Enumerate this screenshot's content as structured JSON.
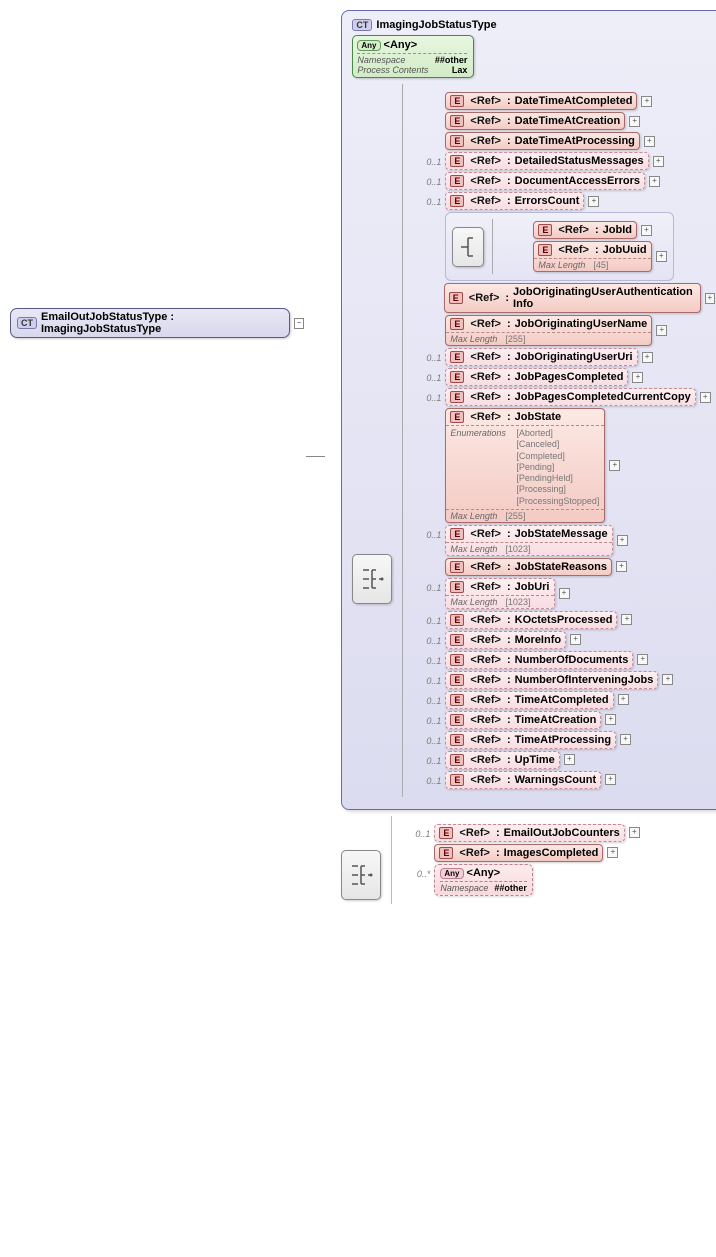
{
  "root": {
    "ct_badge": "CT",
    "label": "EmailOutJobStatusType : ImagingJobStatusType"
  },
  "group": {
    "ct_badge": "CT",
    "title": "ImagingJobStatusType",
    "any": {
      "badge": "Any",
      "title": "<Any>",
      "ns_k": "Namespace",
      "ns_v": "##other",
      "pc_k": "Process Contents",
      "pc_v": "Lax"
    }
  },
  "ref_label": "<Ref>",
  "e_badge": "E",
  "plus": "+",
  "minus": "−",
  "occ01": "0..1",
  "occ0s": "0..*",
  "meta": {
    "maxlen_k": "Max Length",
    "maxlen_45": "[45]",
    "maxlen_255": "[255]",
    "maxlen_1023": "[1023]",
    "enum_k": "Enumerations",
    "ns_k": "Namespace",
    "ns_other": "##other"
  },
  "choice": {
    "jobid": "JobId",
    "jobuuid": "JobUuid"
  },
  "refs": {
    "DateTimeAtCompleted": "DateTimeAtCompleted",
    "DateTimeAtCreation": "DateTimeAtCreation",
    "DateTimeAtProcessing": "DateTimeAtProcessing",
    "DetailedStatusMessages": "DetailedStatusMessages",
    "DocumentAccessErrors": "DocumentAccessErrors",
    "ErrorsCount": "ErrorsCount",
    "JobOriginatingUserAuthenticationInfo": "JobOriginatingUserAuthenticationInfo",
    "JobOriginatingUserName": "JobOriginatingUserName",
    "JobOriginatingUserUri": "JobOriginatingUserUri",
    "JobPagesCompleted": "JobPagesCompleted",
    "JobPagesCompletedCurrentCopy": "JobPagesCompletedCurrentCopy",
    "JobState": "JobState",
    "JobStateMessage": "JobStateMessage",
    "JobStateReasons": "JobStateReasons",
    "JobUri": "JobUri",
    "KOctetsProcessed": "KOctetsProcessed",
    "MoreInfo": "MoreInfo",
    "NumberOfDocuments": "NumberOfDocuments",
    "NumberOfInterveningJobs": "NumberOfInterveningJobs",
    "TimeAtCompleted": "TimeAtCompleted",
    "TimeAtCreation": "TimeAtCreation",
    "TimeAtProcessing": "TimeAtProcessing",
    "UpTime": "UpTime",
    "WarningsCount": "WarningsCount"
  },
  "jobstate_enums": "[Aborted]\n[Canceled]\n[Completed]\n[Pending]\n[PendingHeld]\n[Processing]\n[ProcessingStopped]",
  "ext": {
    "EmailOutJobCounters": "EmailOutJobCounters",
    "ImagesCompleted": "ImagesCompleted",
    "any_title": "<Any>"
  }
}
